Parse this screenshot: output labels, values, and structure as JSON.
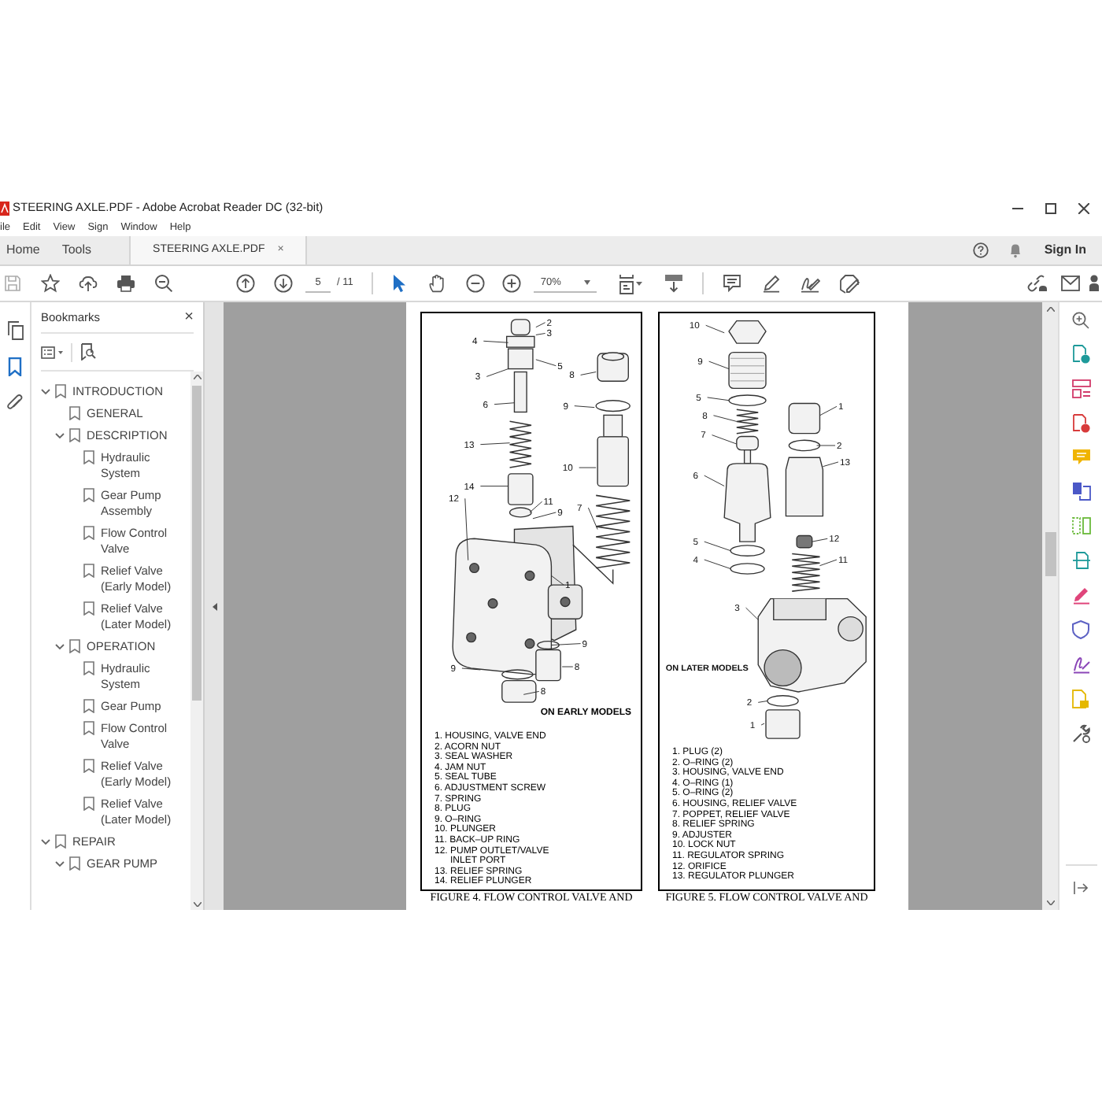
{
  "window": {
    "title": "STEERING AXLE.PDF - Adobe Acrobat Reader DC (32-bit)"
  },
  "menu": [
    "ile",
    "Edit",
    "View",
    "Sign",
    "Window",
    "Help"
  ],
  "tabs": [
    {
      "label": "Home",
      "selected": false
    },
    {
      "label": "Tools",
      "selected": false
    },
    {
      "label": "STEERING AXLE.PDF",
      "selected": true,
      "close": "×"
    }
  ],
  "account": {
    "sign_in": "Sign In"
  },
  "toolbar": {
    "page": "5",
    "page_count": "/ 11",
    "zoom": "70%"
  },
  "bookmarks": {
    "title": "Bookmarks",
    "close": "×",
    "items": [
      {
        "label": "INTRODUCTION",
        "expanded": true,
        "children": [
          {
            "label": "GENERAL"
          },
          {
            "label": "DESCRIPTION",
            "expanded": true,
            "children": [
              {
                "label": "Hydraulic System"
              },
              {
                "label": "Gear Pump Assembly"
              },
              {
                "label": "Flow Control Valve"
              },
              {
                "label": "Relief Valve (Early Model)"
              },
              {
                "label": "Relief Valve (Later Model)"
              }
            ]
          },
          {
            "label": "OPERATION",
            "expanded": true,
            "children": [
              {
                "label": "Hydraulic System"
              },
              {
                "label": "Gear Pump"
              },
              {
                "label": "Flow Control Valve"
              },
              {
                "label": "Relief Valve (Early Model)"
              },
              {
                "label": "Relief Valve (Later Model)"
              }
            ]
          }
        ]
      },
      {
        "label": "REPAIR",
        "expanded": true,
        "children": [
          {
            "label": "GEAR PUMP",
            "expanded": true
          }
        ]
      }
    ]
  },
  "figures": [
    {
      "callouts": [
        "2",
        "3",
        "4",
        "5",
        "3",
        "6",
        "13",
        "14",
        "11",
        "9",
        "12",
        "1",
        "8",
        "9",
        "10",
        "7",
        "9",
        "8",
        "9",
        "8"
      ],
      "model_note": "ON EARLY MODELS",
      "legend": [
        "1. HOUSING, VALVE END",
        "2. ACORN NUT",
        "3. SEAL WASHER",
        "4. JAM NUT",
        "5. SEAL TUBE",
        "6. ADJUSTMENT SCREW",
        "7. SPRING",
        "8. PLUG",
        "9. O–RING",
        "10. PLUNGER",
        "11. BACK–UP RING",
        "12. PUMP OUTLET/VALVE INLET PORT",
        "13. RELIEF SPRING",
        "14. RELIEF PLUNGER"
      ],
      "caption": "FIGURE 4. FLOW CONTROL VALVE AND"
    },
    {
      "callouts": [
        "10",
        "9",
        "5",
        "8",
        "7",
        "6",
        "5",
        "4",
        "3",
        "1",
        "2",
        "13",
        "12",
        "11",
        "2",
        "1"
      ],
      "model_note": "ON LATER MODELS",
      "legend": [
        "1. PLUG (2)",
        "2. O–RING (2)",
        "3. HOUSING, VALVE END",
        "4. O–RING (1)",
        "5. O–RING (2)",
        "6. HOUSING, RELIEF VALVE",
        "7. POPPET, RELIEF VALVE",
        "8. RELIEF SPRING",
        "9. ADJUSTER",
        "10. LOCK NUT",
        "11. REGULATOR SPRING",
        "12. ORIFICE",
        "13. REGULATOR PLUNGER"
      ],
      "caption": "FIGURE 5. FLOW CONTROL VALVE AND"
    }
  ]
}
